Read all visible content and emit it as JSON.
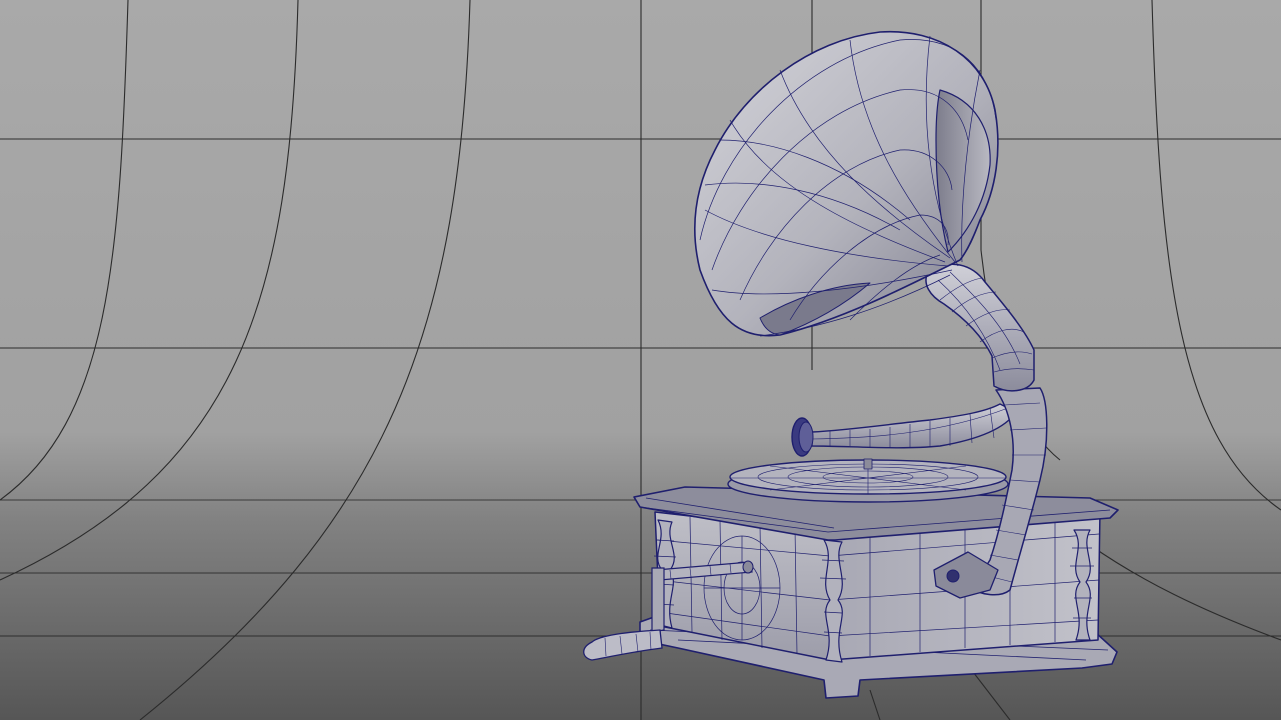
{
  "viewport": {
    "background_top": "#a9a9a9",
    "background_mid": "#a2a2a2",
    "background_bottom": "#585858",
    "grid_color": "#2a2a2a",
    "wire_color": "#1f1f6e",
    "surface_light": "#c9c9cf",
    "surface_mid": "#a3a3ad",
    "surface_dark": "#6f6f80"
  },
  "scene": {
    "object": "gramophone",
    "display_mode": "wireframe-on-shaded"
  }
}
